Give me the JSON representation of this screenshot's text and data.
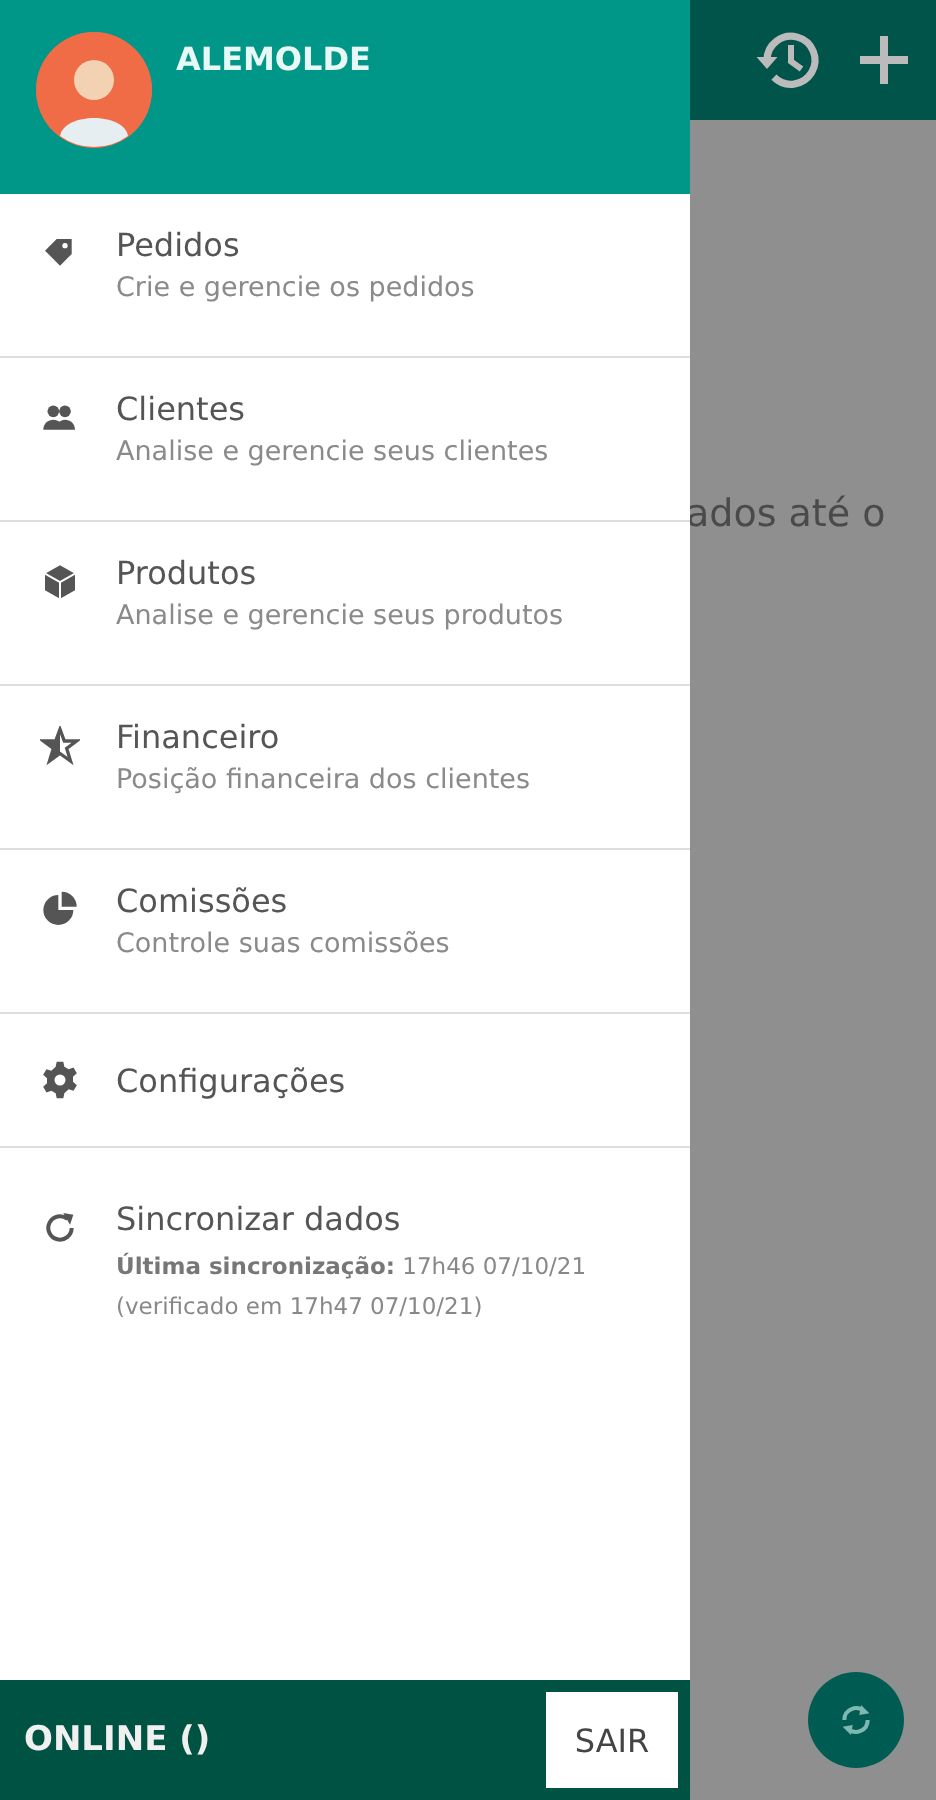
{
  "background": {
    "text": "ados até o"
  },
  "drawer": {
    "user": {
      "name": "ALEMOLDE"
    },
    "items": [
      {
        "kind": "nav",
        "title": "Pedidos",
        "subtitle": "Crie e gerencie os pedidos"
      },
      {
        "kind": "nav",
        "title": "Clientes",
        "subtitle": "Analise e gerencie seus clientes"
      },
      {
        "kind": "nav",
        "title": "Produtos",
        "subtitle": "Analise e gerencie seus produtos"
      },
      {
        "kind": "nav",
        "title": "Financeiro",
        "subtitle": "Posição financeira dos clientes"
      },
      {
        "kind": "nav",
        "title": "Comissões",
        "subtitle": "Controle suas comissões"
      },
      {
        "kind": "single",
        "title": "Configurações"
      },
      {
        "kind": "sync",
        "title": "Sincronizar dados",
        "lines": [
          "**Última sincronização:** 17h46 07/10/21",
          "(verificado em 17h47 07/10/21)"
        ]
      }
    ],
    "footer": {
      "status": "ONLINE ()",
      "button": "SAIR"
    }
  }
}
